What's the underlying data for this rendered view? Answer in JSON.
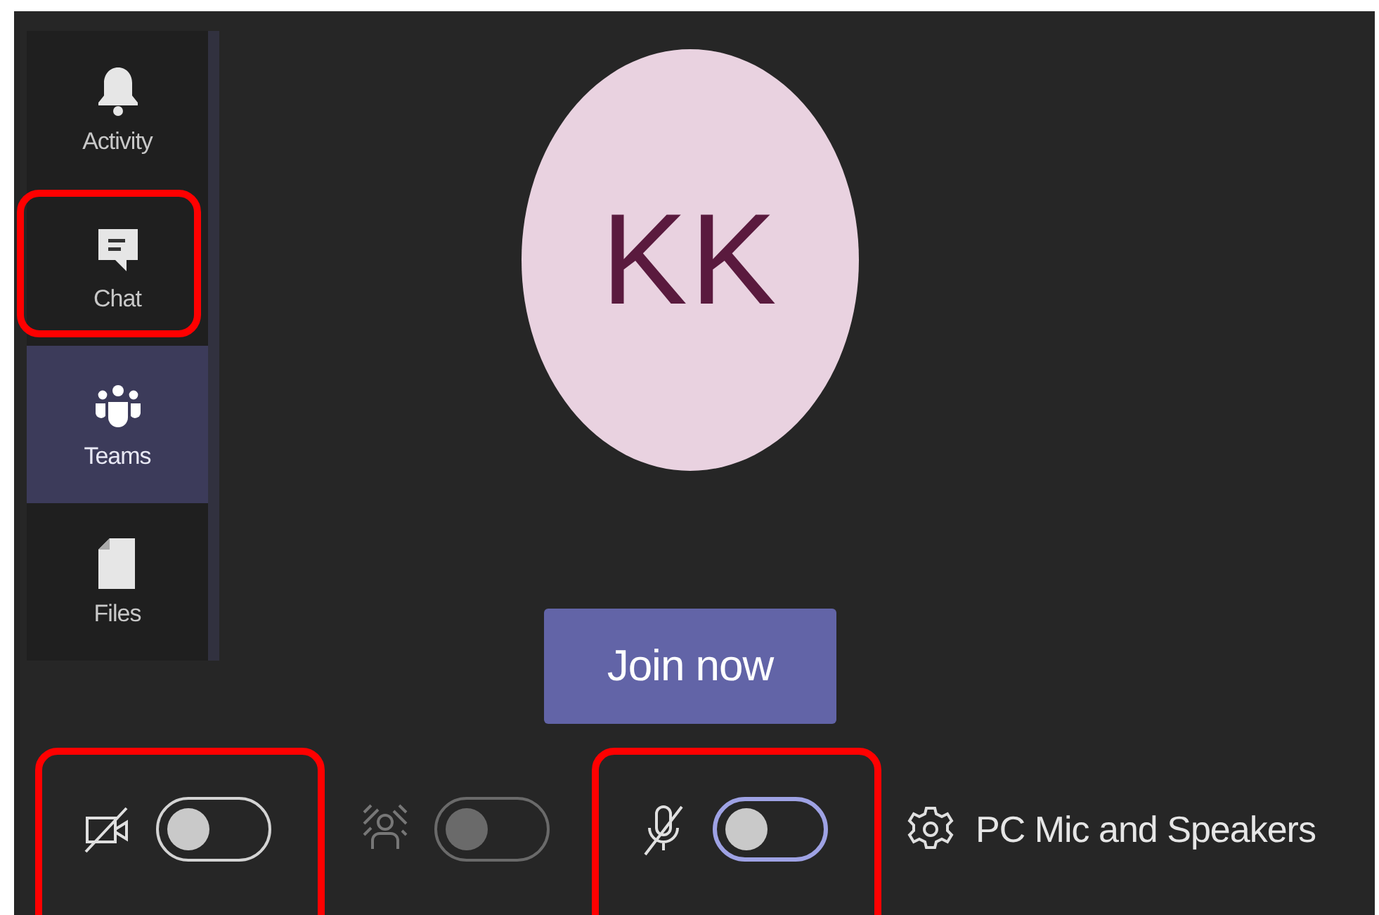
{
  "sidebar": {
    "items": [
      {
        "kind": "activity",
        "label": "Activity",
        "selected": false,
        "highlighted": false
      },
      {
        "kind": "chat",
        "label": "Chat",
        "selected": false,
        "highlighted": true
      },
      {
        "kind": "teams",
        "label": "Teams",
        "selected": true,
        "highlighted": false
      },
      {
        "kind": "files",
        "label": "Files",
        "selected": false,
        "highlighted": false
      }
    ]
  },
  "avatar": {
    "initials": "KK"
  },
  "join_button": {
    "label": "Join now"
  },
  "controls": [
    {
      "kind": "camera",
      "on": false,
      "disabled": false,
      "focused": false,
      "highlighted": true
    },
    {
      "kind": "background",
      "on": false,
      "disabled": true,
      "focused": false,
      "highlighted": false
    },
    {
      "kind": "mic",
      "on": false,
      "disabled": false,
      "focused": true,
      "highlighted": true
    }
  ],
  "device": {
    "label": "PC Mic and Speakers"
  }
}
